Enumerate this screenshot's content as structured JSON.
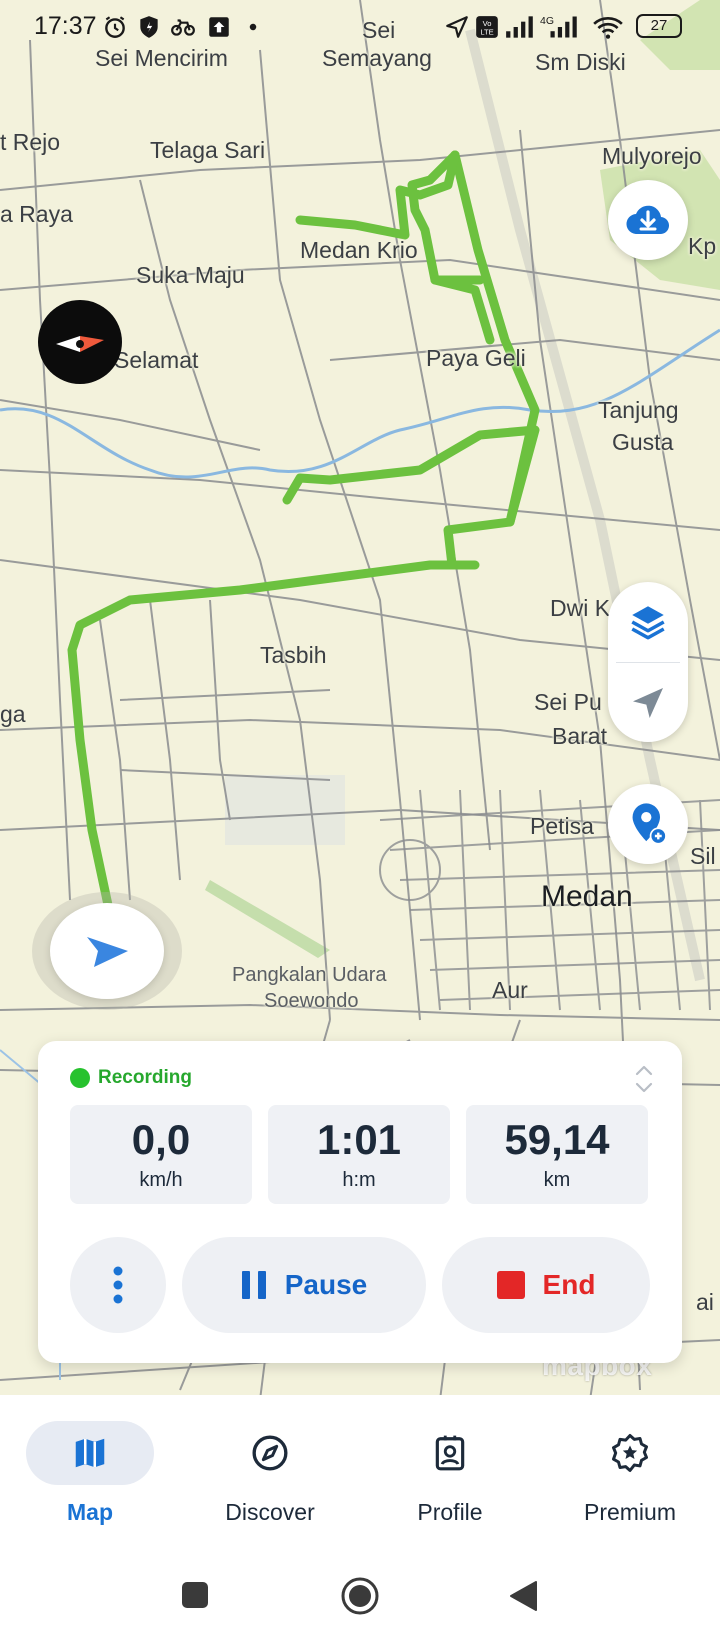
{
  "status_bar": {
    "time": "17:37",
    "icons": [
      "alarm-icon",
      "shield-icon",
      "bike-icon",
      "upload-icon",
      "dot-icon",
      "location-arrow-icon",
      "volte-icon",
      "signal-icon",
      "4g-signal-icon",
      "wifi-icon",
      "battery-icon"
    ],
    "battery": "27"
  },
  "map": {
    "places": [
      "Sei Mencirim",
      "Sei",
      "Semayang",
      "Sm Diski",
      "t Rejo",
      "Telaga Sari",
      "Mulyorejo",
      "a Raya",
      "Kp",
      "Medan Krio",
      "Suka Maju",
      "Selamat",
      "Paya Geli",
      "Tanjung",
      "Gusta",
      "Dwi K",
      "Tasbih",
      "Sei Pu",
      "Barat",
      "ga",
      "Petisa",
      "Sil",
      "Medan",
      "Pangkalan Udara",
      "Soewondo",
      "Aur",
      "ai"
    ],
    "attribution": "mapbox",
    "route_color": "#6cc13f"
  },
  "recording": {
    "status": "Recording",
    "stats": [
      {
        "value": "0,0",
        "unit": "km/h"
      },
      {
        "value": "1:01",
        "unit": "h:m"
      },
      {
        "value": "59,14",
        "unit": "km"
      }
    ],
    "pause_label": "Pause",
    "end_label": "End"
  },
  "nav": {
    "items": [
      {
        "label": "Map",
        "icon": "map-icon"
      },
      {
        "label": "Discover",
        "icon": "compass-icon"
      },
      {
        "label": "Profile",
        "icon": "profile-icon"
      },
      {
        "label": "Premium",
        "icon": "premium-icon"
      }
    ],
    "active": "Map"
  },
  "colors": {
    "accent": "#1a73d4",
    "recording": "#27c22e",
    "end": "#e32727"
  }
}
